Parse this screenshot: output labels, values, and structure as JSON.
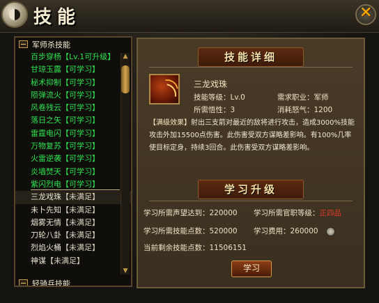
{
  "window": {
    "title": "技能"
  },
  "left_panel": {
    "category1": "军师杀技能",
    "category2": "轻骑兵技能",
    "skills": [
      {
        "name": "百步穿杨",
        "status": "【Lv.1可升级】",
        "style": "green"
      },
      {
        "name": "甘琼玉露",
        "status": "【可学习】",
        "style": "green"
      },
      {
        "name": "秘术抑制",
        "status": "【可学习】",
        "style": "green"
      },
      {
        "name": "陨弹流火",
        "status": "【可学习】",
        "style": "green"
      },
      {
        "name": "风卷残云",
        "status": "【可学习】",
        "style": "green"
      },
      {
        "name": "落日之矢",
        "status": "【可学习】",
        "style": "green"
      },
      {
        "name": "雷霆电闪",
        "status": "【可学习】",
        "style": "green"
      },
      {
        "name": "万物复苏",
        "status": "【可学习】",
        "style": "green"
      },
      {
        "name": "火雷逆袭",
        "status": "【可学习】",
        "style": "green"
      },
      {
        "name": "炎墙焚天",
        "status": "【可学习】",
        "style": "green"
      },
      {
        "name": "紫闪烈电",
        "status": "【可学习】",
        "style": "green"
      },
      {
        "name": "三龙戏珠",
        "status": "【未满足】",
        "style": "gray selected"
      },
      {
        "name": "未卜先知",
        "status": "【未满足】",
        "style": "gray"
      },
      {
        "name": "烟雾无情",
        "status": "【未满足】",
        "style": "gray"
      },
      {
        "name": "刀轮八卦",
        "status": "【未满足】",
        "style": "gray"
      },
      {
        "name": "烈焰火桶",
        "status": "【未满足】",
        "style": "gray"
      },
      {
        "name": "神谋",
        "status": "【未满足】",
        "style": "gray"
      }
    ]
  },
  "detail": {
    "section_title": "技能详细",
    "skill_name": "三龙戏珠",
    "level_label": "技能等级：",
    "level_value": "Lv.0",
    "job_label": "需求职业：",
    "job_value": "军师",
    "insight_label": "所需悟性：",
    "insight_value": "3",
    "anger_label": "消耗怒气：",
    "anger_value": "1200",
    "desc_tag": "【满级效果】",
    "description": "射出三支箭对最近的敌将进行攻击，造成3000%技能攻击外加15500点伤害。此伤害受双方谋略差影响。有100%几率使目标定身，持续3回合。此伤害受双方谋略差影响。"
  },
  "upgrade": {
    "section_title": "学习升级",
    "fame_label": "学习所需声望达到：",
    "fame_value": "220000",
    "rank_label": "学习所需官职等级：",
    "rank_value": "正四品",
    "points_label": "学习所需技能点数：",
    "points_value": "520000",
    "cost_label": "学习费用：",
    "cost_value": "260000",
    "remain_label": "当前剩余技能点数：",
    "remain_value": "11506151",
    "button": "学习"
  },
  "colors": {
    "available": "#2fe050",
    "warning": "#e23b2a"
  },
  "icons": [
    "yin-yang-icon",
    "close-icon",
    "minus-icon",
    "skill-icon",
    "coin-icon"
  ]
}
